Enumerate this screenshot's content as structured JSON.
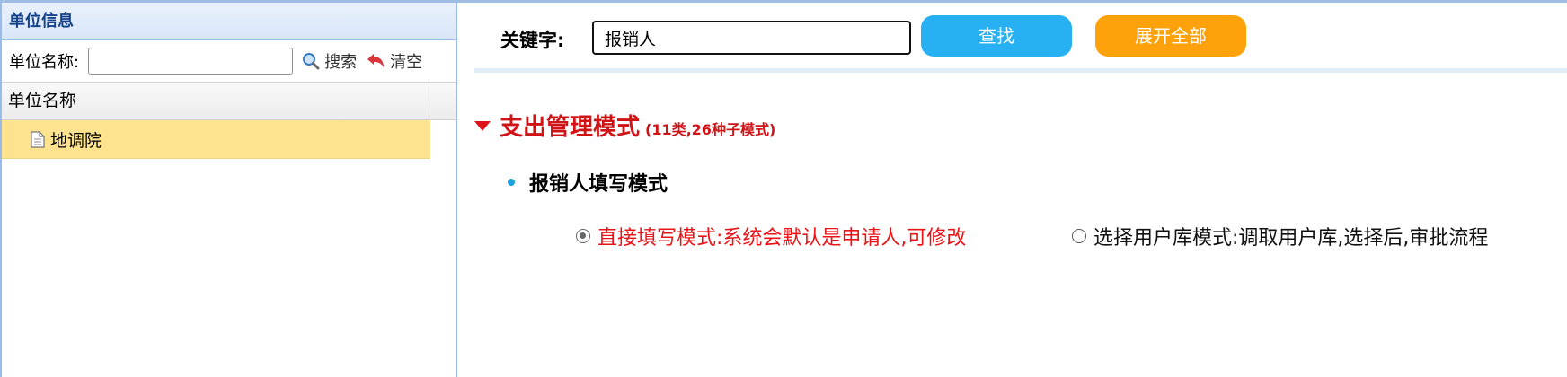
{
  "left_panel": {
    "title": "单位信息",
    "filter_label": "单位名称:",
    "filter_value": "",
    "search_label": "搜索",
    "clear_label": "清空",
    "column_header": "单位名称",
    "rows": [
      {
        "label": "地调院",
        "selected": true
      }
    ]
  },
  "search": {
    "keyword_label": "关键字:",
    "keyword_value": "报销人",
    "find_label": "查找",
    "expand_label": "展开全部"
  },
  "section": {
    "title": "支出管理模式",
    "subtitle": "(11类,26种子模式)",
    "group_title": "报销人填写模式",
    "options": [
      {
        "label": "直接填写模式:系统会默认是申请人,可修改",
        "selected": true
      },
      {
        "label": "选择用户库模式:调取用户库,选择后,审批流程",
        "selected": false
      }
    ]
  },
  "colors": {
    "find_button": "#27b0f2",
    "expand_button": "#fda20a",
    "section_red": "#cf1418",
    "selected_row": "#fde390"
  }
}
